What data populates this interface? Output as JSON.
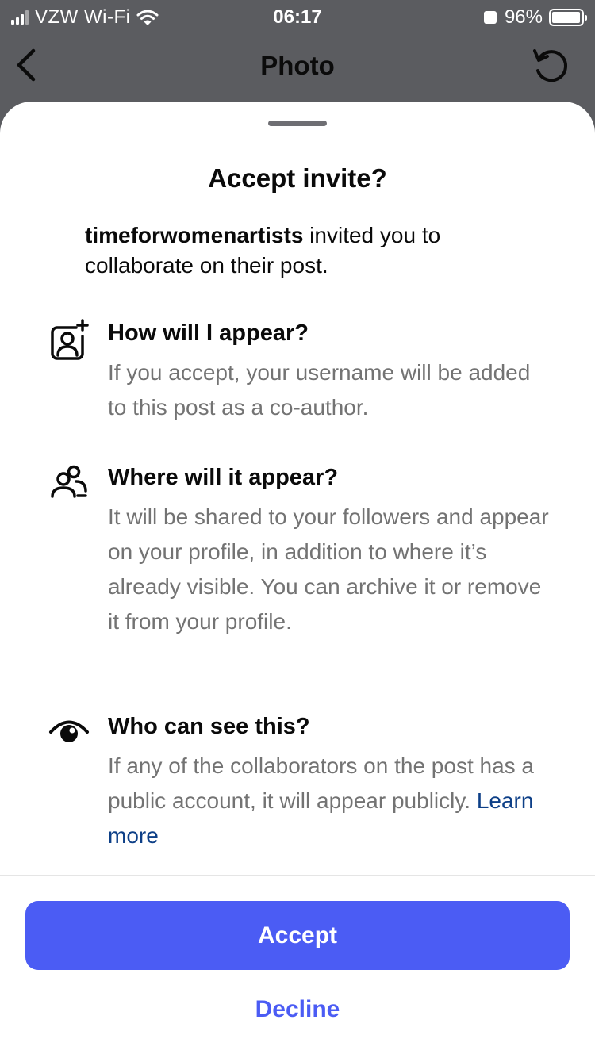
{
  "status_bar": {
    "carrier": "VZW Wi-Fi",
    "time": "06:17",
    "battery_percent": "96%",
    "battery_level": 0.96
  },
  "nav": {
    "title": "Photo",
    "back_icon": "chevron-left-icon",
    "refresh_icon": "refresh-icon"
  },
  "sheet": {
    "title": "Accept invite?",
    "intro": {
      "username": "timeforwomenartists",
      "text": " invited you to collaborate on their post."
    },
    "sections": [
      {
        "icon": "add-person-icon",
        "heading": "How will I appear?",
        "body": "If you accept, your username will be added to this post as a co-author."
      },
      {
        "icon": "people-icon",
        "heading": "Where will it appear?",
        "body": "It will be shared to your followers and appear on your profile, in addition to where it’s already visible. You can archive it or remove it from your profile."
      },
      {
        "icon": "eye-icon",
        "heading": "Who can see this?",
        "body": "If any of the collaborators on the post has a public account, it will appear publicly. ",
        "link": "Learn more"
      }
    ],
    "accept_label": "Accept",
    "decline_label": "Decline"
  },
  "colors": {
    "accent": "#4b5cf4",
    "link": "#0d3f87",
    "secondary_text": "#737373",
    "backdrop": "#5b5c60"
  }
}
